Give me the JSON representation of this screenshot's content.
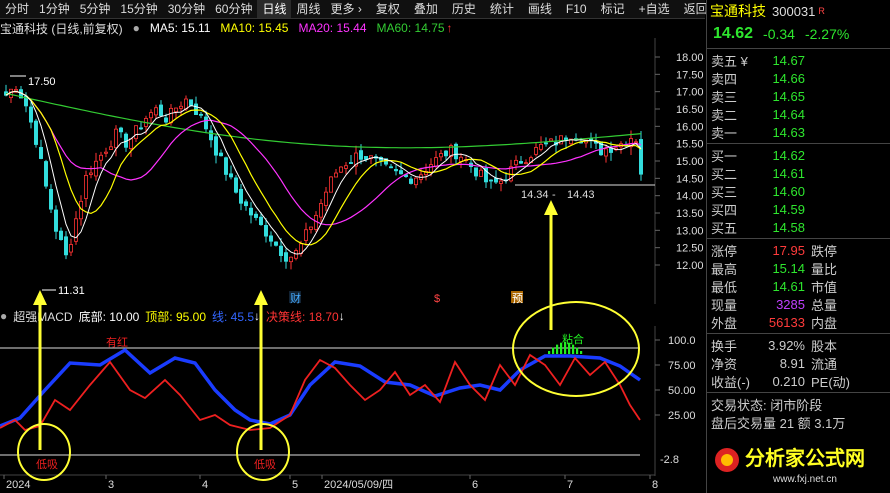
{
  "toolbar": {
    "items": [
      "分时",
      "1分钟",
      "5分钟",
      "15分钟",
      "30分钟",
      "60分钟",
      "日线",
      "周线",
      "更多 ›"
    ],
    "right_items": [
      "复权",
      "叠加",
      "历史",
      "统计",
      "画线",
      "F10",
      "标记",
      "+自选",
      "返回"
    ],
    "active": "日线"
  },
  "infoline": {
    "name": "宝通科技 (日线,前复权)",
    "ma5": "MA5: 15.11",
    "ma10": "MA10: 15.45",
    "ma20": "MA20: 15.44",
    "ma60": "MA60: 14.75"
  },
  "colors": {
    "ma5": "#ffffff",
    "ma10": "#ffff00",
    "ma20": "#ff33ff",
    "ma60": "#33cc33",
    "up": "#ff3333",
    "down": "#33dddd"
  },
  "price_axis": [
    "18.00",
    "17.50",
    "17.00",
    "16.50",
    "16.00",
    "15.50",
    "15.00",
    "14.50",
    "14.00",
    "13.50",
    "13.00",
    "12.50",
    "12.00"
  ],
  "annotations": {
    "high": "17.50",
    "low": "11.31",
    "range_left": "14.34",
    "range_right": "14.43",
    "marker_cai": "财",
    "marker_s": "$",
    "marker_yu": "预"
  },
  "indicator": {
    "title": "超强MACD",
    "bottom": "底部: 10.00",
    "top": "顶部: 95.00",
    "mid": "线: 45.5",
    "decision": "决策线: 18.70",
    "label_youhong": "有红",
    "label_dixi1": "低吸",
    "label_dixi2": "低吸",
    "label_zhanghe": "粘合",
    "axis": [
      "100.0",
      "75.00",
      "50.00",
      "25.00"
    ],
    "axis_bottom": "-2.8",
    "dates": [
      "2024",
      "3",
      "4",
      "5",
      "2024/05/09/四",
      "6",
      "7",
      "8"
    ]
  },
  "stock": {
    "name": "宝通科技",
    "code": "300031",
    "badge": "R",
    "price": "14.62",
    "change": "-0.34",
    "pct": "-2.27%"
  },
  "asks": [
    {
      "label": "卖五 ¥",
      "price": "14.67"
    },
    {
      "label": "卖四",
      "price": "14.66"
    },
    {
      "label": "卖三",
      "price": "14.65"
    },
    {
      "label": "卖二",
      "price": "14.64"
    },
    {
      "label": "卖一",
      "price": "14.63"
    }
  ],
  "bids": [
    {
      "label": "买一",
      "price": "14.62"
    },
    {
      "label": "买二",
      "price": "14.61"
    },
    {
      "label": "买三",
      "price": "14.60"
    },
    {
      "label": "买四",
      "price": "14.59"
    },
    {
      "label": "买五",
      "price": "14.58"
    }
  ],
  "stats": [
    {
      "l1": "涨停",
      "v1": "17.95",
      "l2": "跌停"
    },
    {
      "l1": "最高",
      "v1": "15.14",
      "l2": "量比"
    },
    {
      "l1": "最低",
      "v1": "14.61",
      "l2": "市值"
    },
    {
      "l1": "现量",
      "v1": "3285",
      "l2": "总量"
    },
    {
      "l1": "外盘",
      "v1": "56133",
      "l2": "内盘"
    }
  ],
  "stats2": [
    {
      "l1": "换手",
      "v1": "3.92%",
      "l2": "股本"
    },
    {
      "l1": "净资",
      "v1": "8.91",
      "l2": "流通"
    },
    {
      "l1": "收益(-)",
      "v1": "0.210",
      "l2": "PE(动)"
    }
  ],
  "trade_status": "交易状态: 闭市阶段",
  "after_hours": "盘后交易量 21 额 3.1万",
  "logo_text": "分析家公式网",
  "logo_url": "www.fxj.net.cn"
}
